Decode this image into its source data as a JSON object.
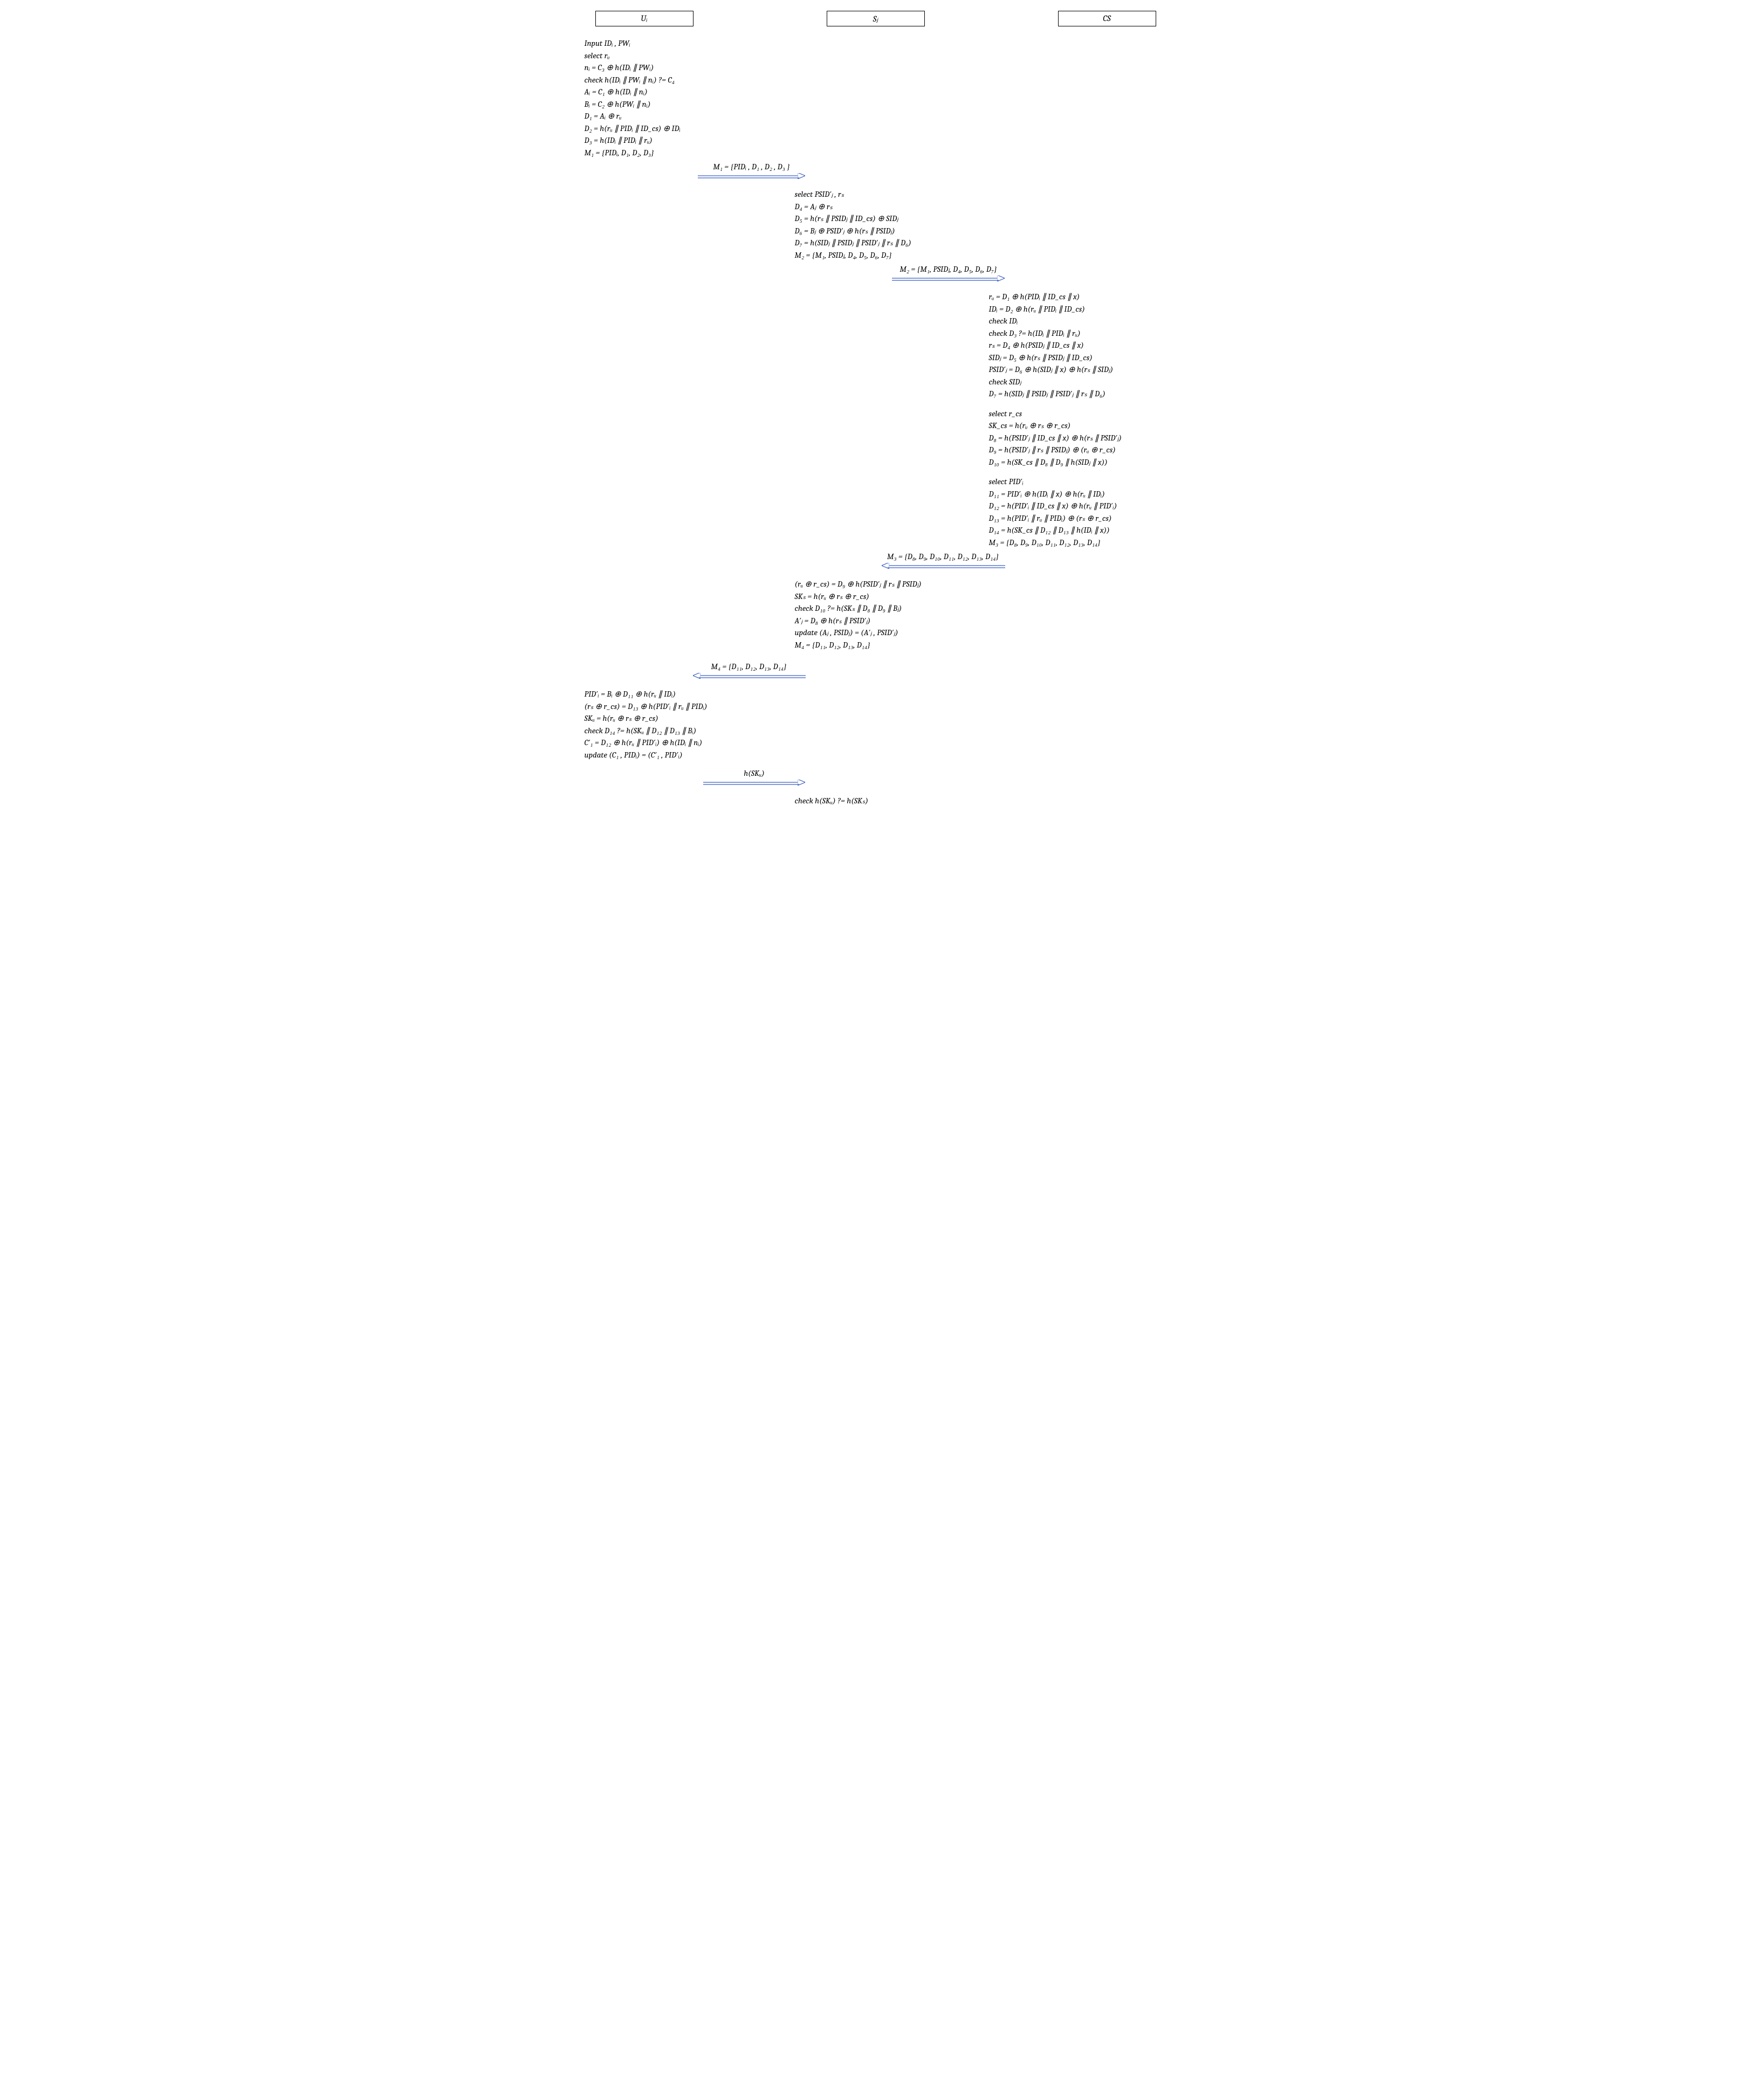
{
  "headers": {
    "ui": "Uᵢ",
    "sj": "Sⱼ",
    "cs": "CS"
  },
  "ui_initial": [
    "Input IDᵢ , PWᵢ",
    "select rᵤ",
    "nᵢ = C₃ ⊕ h(IDᵢ ∥ PWᵢ)",
    "check h(IDᵢ ∥ PWᵢ ∥ nᵢ) ?= C₄",
    "Aᵢ = C₁ ⊕ h(IDᵢ ∥ nᵢ)",
    "Bᵢ = C₂ ⊕ h(PWᵢ ∥ nᵢ)",
    "D₁ = Aᵢ ⊕ rᵤ",
    "D₂ = h(rᵤ ∥ PIDᵢ ∥ ID_cs) ⊕ IDᵢ",
    "D₃ = h(IDᵢ ∥ PIDᵢ ∥ rᵤ)",
    "M₁ = {PIDᵢ, D₁, D₂, D₃}"
  ],
  "arrow_M1": "M₁ = {PIDᵢ , D₁ , D₂ , D₃ }",
  "sj_recv_M1": [
    "select PSID′ⱼ , rₛ",
    "D₄ = Aⱼ ⊕ rₛ",
    "D₅ = h(rₛ ∥ PSIDⱼ ∥ ID_cs) ⊕ SIDⱼ",
    "D₆ = Bⱼ ⊕ PSID′ⱼ ⊕ h(rₛ ∥ PSIDⱼ)",
    "D₇ = h(SIDⱼ ∥ PSIDⱼ ∥ PSID′ⱼ ∥ rₛ ∥ D₆)",
    "M₂ = {M₁, PSIDⱼ, D₄, D₅, D₆, D₇}"
  ],
  "arrow_M2": "M₂ = {M₁, PSIDⱼ, D₄, D₅, D₆, D₇}",
  "cs_recv_M2_a": [
    "rᵤ = D₁ ⊕ h(PIDᵢ ∥ ID_cs ∥ x)",
    "IDᵢ = D₂ ⊕ h(rᵤ ∥ PIDᵢ ∥ ID_cs)",
    "check IDᵢ",
    "check D₃ ?= h(IDᵢ ∥ PIDᵢ ∥ rᵤ)",
    "rₛ = D₄ ⊕ h(PSIDⱼ ∥ ID_cs ∥ x)",
    "SIDⱼ = D₅ ⊕ h(rₛ ∥ PSIDⱼ ∥ ID_cs)",
    "PSID′ⱼ = D₆ ⊕ h(SIDⱼ ∥ x) ⊕ h(rₛ ∥ SIDⱼ)",
    "check SIDⱼ",
    "D₇ = h(SIDⱼ ∥ PSIDⱼ ∥ PSID′ⱼ ∥ rₛ ∥ D₆)"
  ],
  "cs_recv_M2_b": [
    "select r_cs",
    "SK_cs = h(rᵤ ⊕ rₛ ⊕ r_cs)",
    "D₈ = h(PSID′ⱼ ∥ ID_cs ∥ x) ⊕ h(rₛ ∥ PSID′ⱼ)",
    "D₉ = h(PSID′ⱼ ∥ rₛ ∥ PSIDⱼ) ⊕ (rᵤ ⊕ r_cs)",
    "D₁₀ = h(SK_cs ∥ D₈ ∥ D₉ ∥ h(SIDⱼ ∥ x))"
  ],
  "cs_recv_M2_c": [
    "select PID′ᵢ",
    "D₁₁ = PID′ᵢ ⊕ h(IDᵢ ∥ x) ⊕ h(rᵤ ∥ IDᵢ)",
    "D₁₂ = h(PID′ᵢ ∥ ID_cs ∥ x) ⊕ h(rᵤ ∥ PID′ᵢ)",
    "D₁₃ = h(PID′ᵢ ∥ rᵤ ∥ PIDᵢ) ⊕ (rₛ ⊕ r_cs)",
    "D₁₄ = h(SK_cs ∥ D₁₂ ∥ D₁₃ ∥ h(IDᵢ ∥ x))",
    "M₃ = {D₈, D₉, D₁₀, D₁₁, D₁₂, D₁₃, D₁₄}"
  ],
  "arrow_M3": "M₃ = {D₈, D₉, D₁₀, D₁₁, D₁₂, D₁₃, D₁₄}",
  "sj_recv_M3": [
    "(rᵤ ⊕ r_cs) = D₉ ⊕ h(PSID′ⱼ ∥ rₛ ∥ PSIDⱼ)",
    "SKₛ = h(rᵤ ⊕ rₛ ⊕ r_cs)",
    "check D₁₀ ?= h(SKₛ ∥ D₈ ∥ D₉ ∥ Bⱼ)",
    "A′ⱼ = D₈ ⊕ h(rₛ ∥ PSID′ⱼ)",
    "update (Aⱼ , PSIDⱼ) = (A′ⱼ , PSID′ⱼ)",
    "M₄ = {D₁₁, D₁₂, D₁₃, D₁₄}"
  ],
  "arrow_M4": "M₄ = {D₁₁, D₁₂, D₁₃, D₁₄}",
  "ui_recv_M4": [
    "PID′ᵢ = Bᵢ ⊕ D₁₁ ⊕ h(rᵤ ∥ IDᵢ)",
    "(rₛ ⊕ r_cs) = D₁₃ ⊕ h(PID′ᵢ ∥ rᵤ ∥ PIDᵢ)",
    "SKᵤ = h(rᵤ ⊕ rₛ ⊕ r_cs)",
    "check D₁₄ ?= h(SKᵤ ∥ D₁₂ ∥ D₁₃ ∥ Bᵢ)",
    "C′₁ = D₁₂ ⊕ h(rᵤ ∥ PID′ᵢ) ⊕ h(IDᵢ ∥ nᵢ)",
    "update (C₁ , PIDᵢ) = (C′₁ , PID′ᵢ)"
  ],
  "arrow_hSKu": "h(SKᵤ)",
  "sj_final": [
    "check h(SKᵤ) ?= h(SKₛ)"
  ]
}
